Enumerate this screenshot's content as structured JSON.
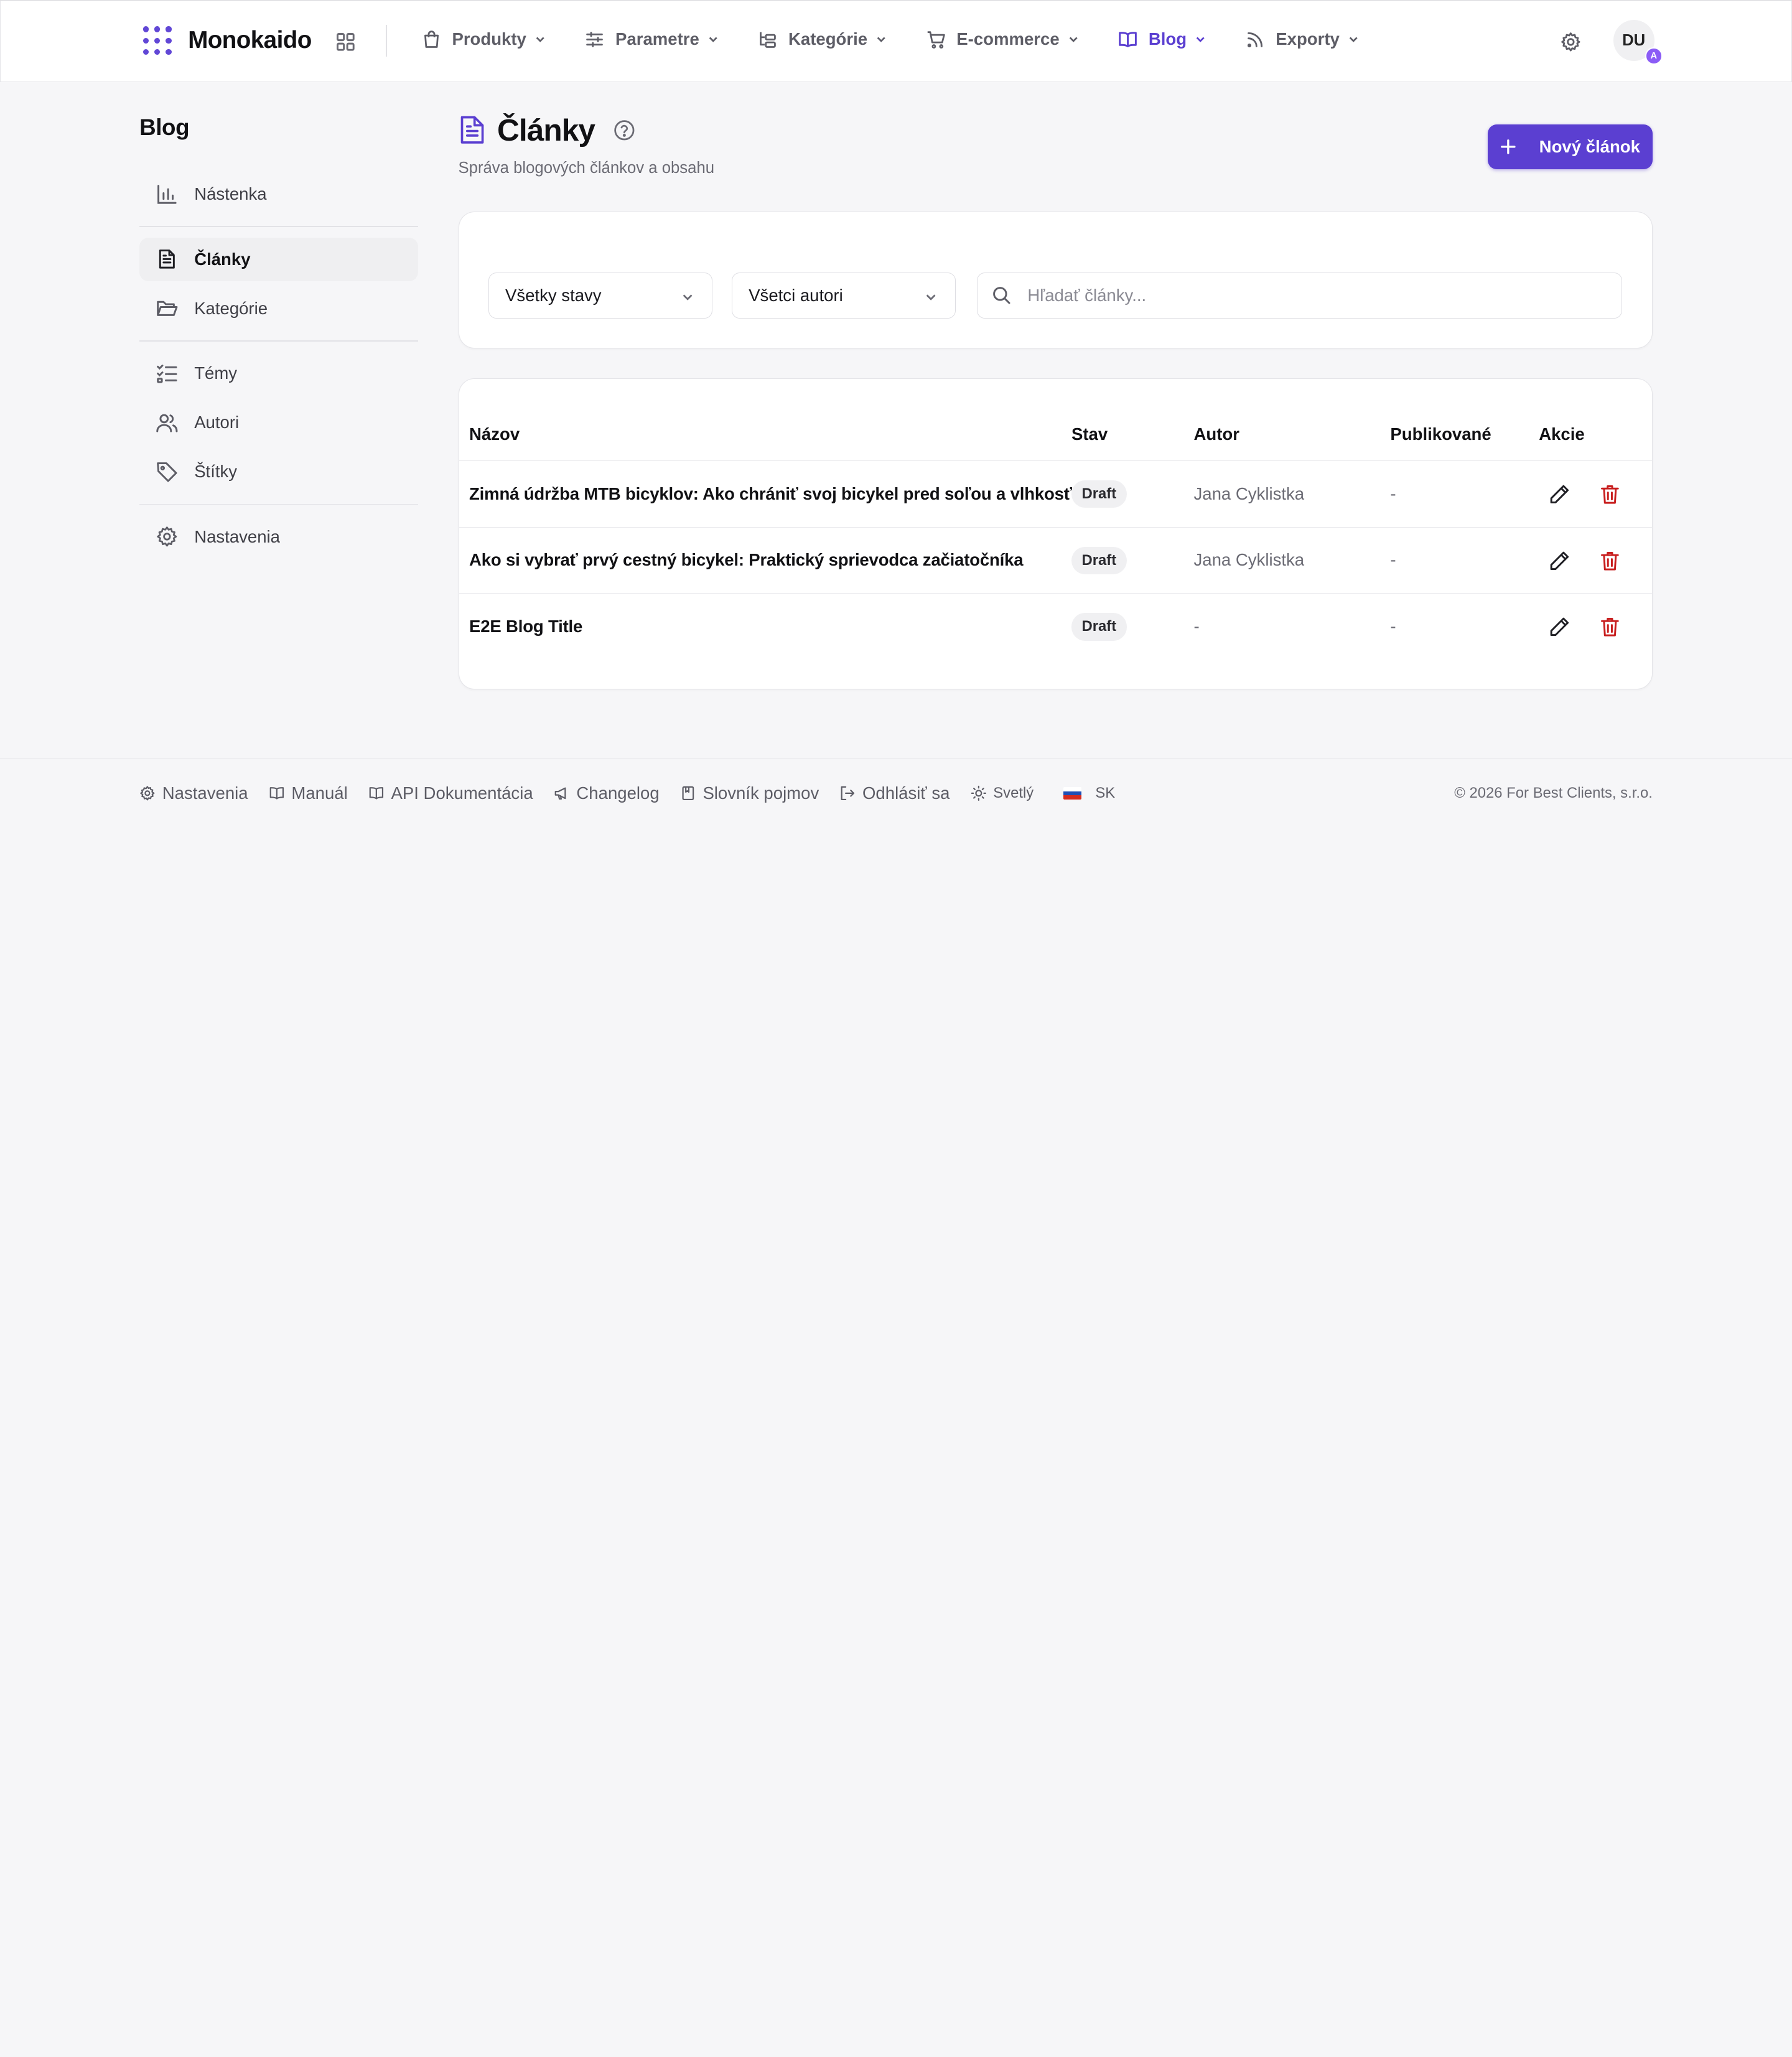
{
  "brand": {
    "name": "Monokaido",
    "accent": "#5b3fd1"
  },
  "nav": {
    "items": [
      {
        "label": "Produkty",
        "icon": "shopping-bag-icon"
      },
      {
        "label": "Parametre",
        "icon": "sliders-icon"
      },
      {
        "label": "Kategórie",
        "icon": "folder-tree-icon"
      },
      {
        "label": "E-commerce",
        "icon": "cart-icon"
      },
      {
        "label": "Blog",
        "icon": "book-icon",
        "active": true
      },
      {
        "label": "Exporty",
        "icon": "rss-icon"
      }
    ],
    "avatar_initials": "DU",
    "avatar_badge": "A"
  },
  "sidebar": {
    "title": "Blog",
    "items": [
      {
        "label": "Nástenka",
        "icon": "bar-chart-icon"
      },
      {
        "label": "Články",
        "icon": "document-icon",
        "active": true
      },
      {
        "label": "Kategórie",
        "icon": "folder-open-icon"
      },
      {
        "label": "Témy",
        "icon": "list-check-icon"
      },
      {
        "label": "Autori",
        "icon": "users-icon"
      },
      {
        "label": "Štítky",
        "icon": "tag-icon"
      },
      {
        "label": "Nastavenia",
        "icon": "gear-icon"
      }
    ]
  },
  "header": {
    "title": "Články",
    "subtitle": "Správa blogových článkov a obsahu",
    "new_button": "Nový článok"
  },
  "filters": {
    "status_selected": "Všetky stavy",
    "author_selected": "Všetci autori",
    "search_placeholder": "Hľadať články...",
    "search_value": ""
  },
  "table": {
    "columns": [
      "Názov",
      "Stav",
      "Autor",
      "Publikované",
      "Akcie"
    ],
    "rows": [
      {
        "title": "Zimná údržba MTB bicyklov: Ako chrániť svoj bicykel pred soľou a vlhkosťou",
        "status": "Draft",
        "author": "Jana Cyklistka",
        "published": "-"
      },
      {
        "title": "Ako si vybrať prvý cestný bicykel: Praktický sprievodca začiatočníka",
        "status": "Draft",
        "author": "Jana Cyklistka",
        "published": "-"
      },
      {
        "title": "E2E Blog Title",
        "status": "Draft",
        "author": "-",
        "published": "-"
      }
    ]
  },
  "footer": {
    "links": [
      "Nastavenia",
      "Manuál",
      "API Dokumentácia",
      "Changelog",
      "Slovník pojmov",
      "Odhlásiť sa"
    ],
    "theme": "Svetlý",
    "language": "SK",
    "copyright": "© 2026 For Best Clients, s.r.o."
  },
  "colors": {
    "delete": "#c81e1e",
    "muted": "#6b6b74"
  }
}
